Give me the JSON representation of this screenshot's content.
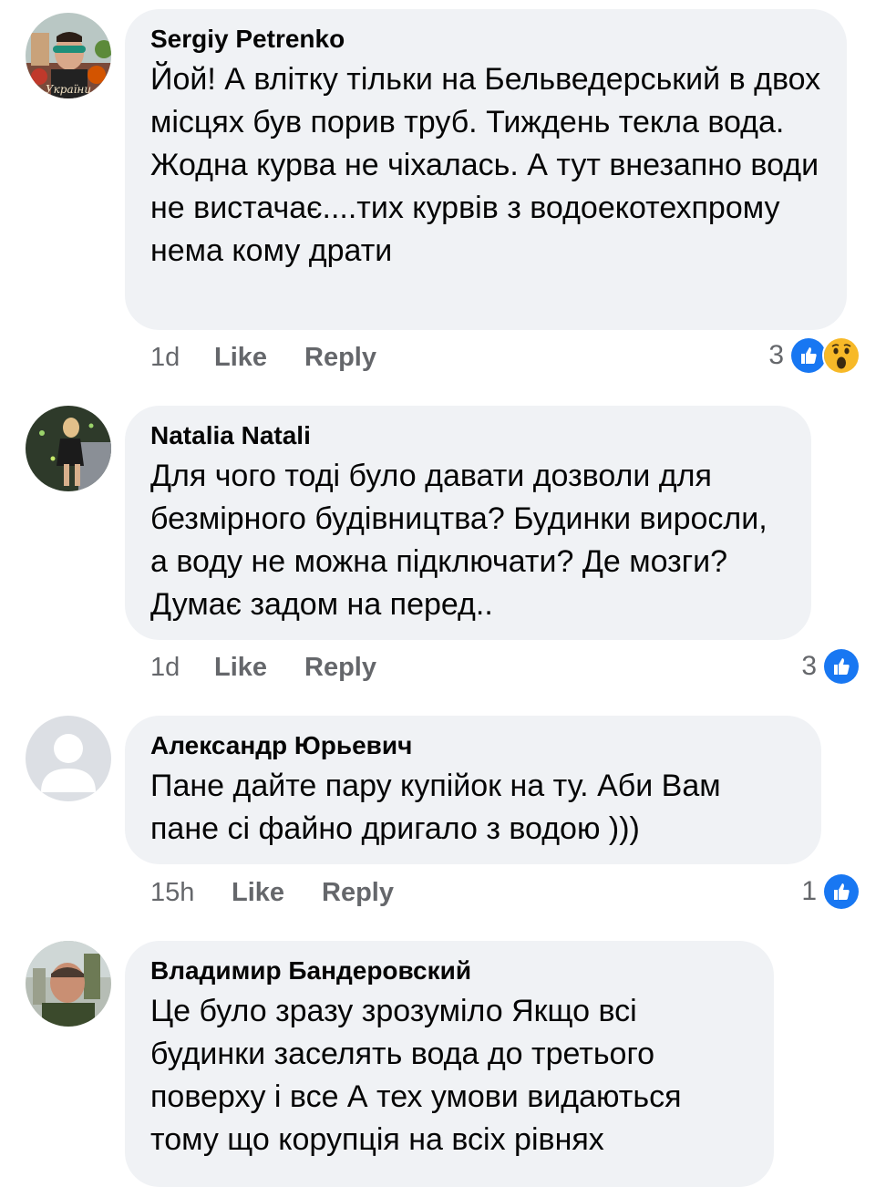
{
  "comments": [
    {
      "author": "Sergiy Petrenko",
      "text": "Йой! А влітку тільки на Бельведерський в двох місцях був порив труб. Тиждень текла вода. Жодна курва не чіхалась. А тут внезапно води не вистачає....тих курвів з водоекотехпрому нема кому драти",
      "time": "1d",
      "like_label": "Like",
      "reply_label": "Reply",
      "reaction_count": "3",
      "reactions": [
        "like-icon",
        "wow-icon"
      ]
    },
    {
      "author": "Natalia Natali",
      "text": "Для чого тоді було давати дозволи для безмірного будівництва? Будинки виросли, а воду не можна підключати? Де мозги? Думає задом на перед..",
      "time": "1d",
      "like_label": "Like",
      "reply_label": "Reply",
      "reaction_count": "3",
      "reactions": [
        "like-icon"
      ]
    },
    {
      "author": "Александр Юрьевич",
      "text": "Пане дайте пару купійок на ту. Аби Вам пане сі файно дригало з водою )))",
      "time": "15h",
      "like_label": "Like",
      "reply_label": "Reply",
      "reaction_count": "1",
      "reactions": [
        "like-icon"
      ]
    },
    {
      "author": "Владимир Бандеровский",
      "text": "Це було зразу зрозуміло Якщо всі будинки заселять вода до третього поверху і все А тех умови видаються тому що корупція на всіх рівнях",
      "time": "",
      "like_label": "",
      "reply_label": "",
      "reaction_count": "",
      "reactions": []
    }
  ],
  "colors": {
    "bubble": "#f0f2f5",
    "meta": "#65676b",
    "like_blue": "#1877f2",
    "wow_yellow": "#f7b928"
  }
}
